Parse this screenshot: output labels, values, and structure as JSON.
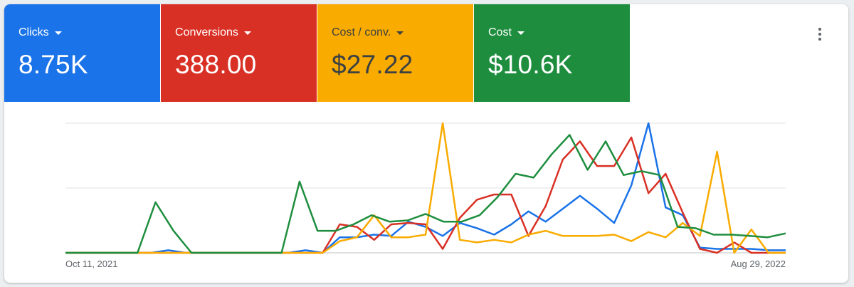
{
  "metrics": [
    {
      "label": "Clicks",
      "value": "8.75K",
      "bg": "#1a73e8",
      "fg": "#ffffff"
    },
    {
      "label": "Conversions",
      "value": "388.00",
      "bg": "#d93025",
      "fg": "#ffffff"
    },
    {
      "label": "Cost / conv.",
      "value": "$27.22",
      "bg": "#f9ab00",
      "fg": "#3c4043"
    },
    {
      "label": "Cost",
      "value": "$10.6K",
      "bg": "#1e8e3e",
      "fg": "#ffffff"
    }
  ],
  "chart_data": {
    "type": "line",
    "x_start_label": "Oct 11, 2021",
    "x_end_label": "Aug 29, 2022",
    "grid": true,
    "ylim": [
      0,
      100
    ],
    "series": [
      {
        "color": "#1a73e8",
        "values": [
          0,
          0,
          0,
          0,
          0,
          0,
          2,
          0,
          0,
          0,
          0,
          0,
          0,
          0,
          2,
          0,
          12,
          12,
          14,
          13,
          24,
          20,
          13,
          23,
          19,
          14,
          22,
          32,
          24,
          34,
          44,
          34,
          23,
          52,
          100,
          35,
          29,
          4,
          3,
          3,
          3,
          2,
          2
        ]
      },
      {
        "color": "#d93025",
        "values": [
          0,
          0,
          0,
          0,
          0,
          0,
          0,
          0,
          0,
          0,
          0,
          0,
          0,
          0,
          0,
          0,
          22,
          20,
          10,
          22,
          23,
          22,
          3,
          27,
          41,
          45,
          45,
          13,
          36,
          72,
          86,
          67,
          67,
          89,
          46,
          61,
          31,
          3,
          0,
          8,
          0,
          0,
          0
        ]
      },
      {
        "color": "#f9ab00",
        "values": [
          0,
          0,
          0,
          0,
          0,
          0,
          0,
          0,
          0,
          0,
          0,
          0,
          0,
          0,
          0,
          0,
          9,
          12,
          29,
          12,
          12,
          14,
          100,
          10,
          8,
          10,
          8,
          14,
          17,
          13,
          13,
          13,
          14,
          9,
          16,
          12,
          23,
          13,
          78,
          0,
          18,
          0,
          0
        ]
      },
      {
        "color": "#1e8e3e",
        "values": [
          0,
          0,
          0,
          0,
          0,
          39,
          17,
          0,
          0,
          0,
          0,
          0,
          0,
          55,
          17,
          17,
          22,
          29,
          24,
          25,
          30,
          24,
          24,
          29,
          43,
          61,
          58,
          76,
          91,
          64,
          86,
          60,
          63,
          60,
          20,
          19,
          14,
          14,
          13,
          12,
          15
        ]
      }
    ]
  }
}
